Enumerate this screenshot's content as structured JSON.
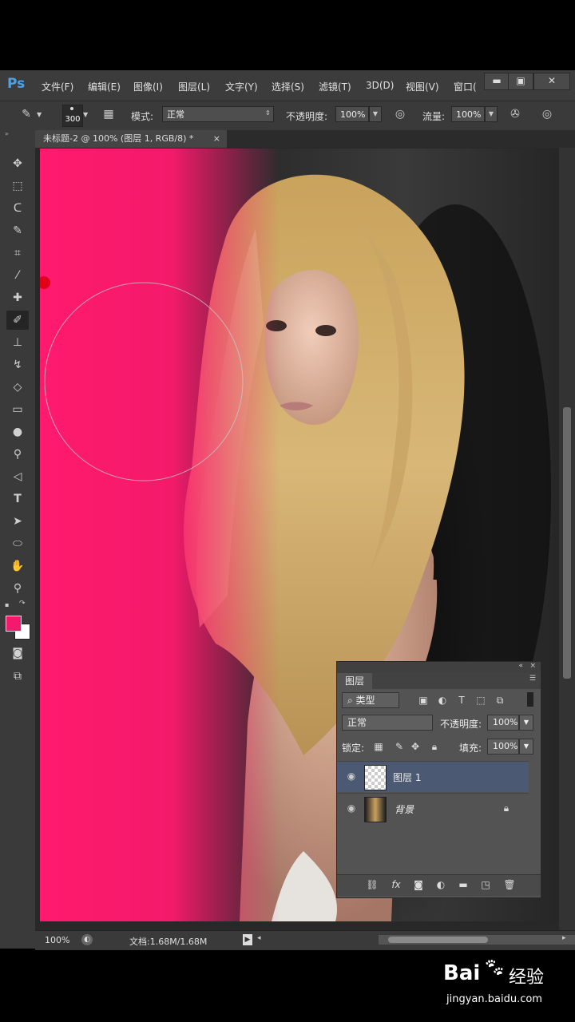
{
  "app": {
    "logo": "Ps"
  },
  "menu": {
    "items": [
      "文件(F)",
      "编辑(E)",
      "图像(I)",
      "图层(L)",
      "文字(Y)",
      "选择(S)",
      "滤镜(T)",
      "3D(D)",
      "视图(V)",
      "窗口("
    ],
    "window_buttons": [
      "▬",
      "▣",
      "✕"
    ]
  },
  "options": {
    "brush_size": "300",
    "mode_label": "模式:",
    "mode_value": "正常",
    "opacity_label": "不透明度:",
    "opacity_value": "100%",
    "flow_label": "流量:",
    "flow_value": "100%"
  },
  "document": {
    "tab_title": "未标题-2 @ 100% (图层 1, RGB/8) *",
    "tab_close": "×"
  },
  "toolbar": {
    "tools": [
      "move-icon",
      "marquee-icon",
      "lasso-icon",
      "quick-select-icon",
      "crop-icon",
      "eyedropper-icon",
      "healing-icon",
      "brush-icon",
      "stamp-icon",
      "history-brush-icon",
      "eraser-icon",
      "gradient-icon",
      "blur-icon",
      "dodge-icon",
      "pen-icon",
      "type-icon",
      "path-select-icon",
      "shape-icon",
      "hand-icon",
      "zoom-icon"
    ],
    "foreground_color": "#f5196e",
    "background_color": "#ffffff"
  },
  "status": {
    "zoom": "100%",
    "doc_info": "文档:1.68M/1.68M"
  },
  "layers_panel": {
    "tab": "图层",
    "filter_label": "类型",
    "blend_mode": "正常",
    "opacity_label": "不透明度:",
    "opacity_value": "100%",
    "lock_label": "锁定:",
    "fill_label": "填充:",
    "fill_value": "100%",
    "layers": [
      {
        "name": "图层 1",
        "selected": true
      },
      {
        "name": "背景",
        "locked": true
      }
    ]
  },
  "colors": {
    "paint": "#ff1a6e",
    "selection_blue": "#4b5a72"
  },
  "watermark": {
    "brand": "Bai",
    "brand2": "经验",
    "url": "jingyan.baidu.com"
  }
}
